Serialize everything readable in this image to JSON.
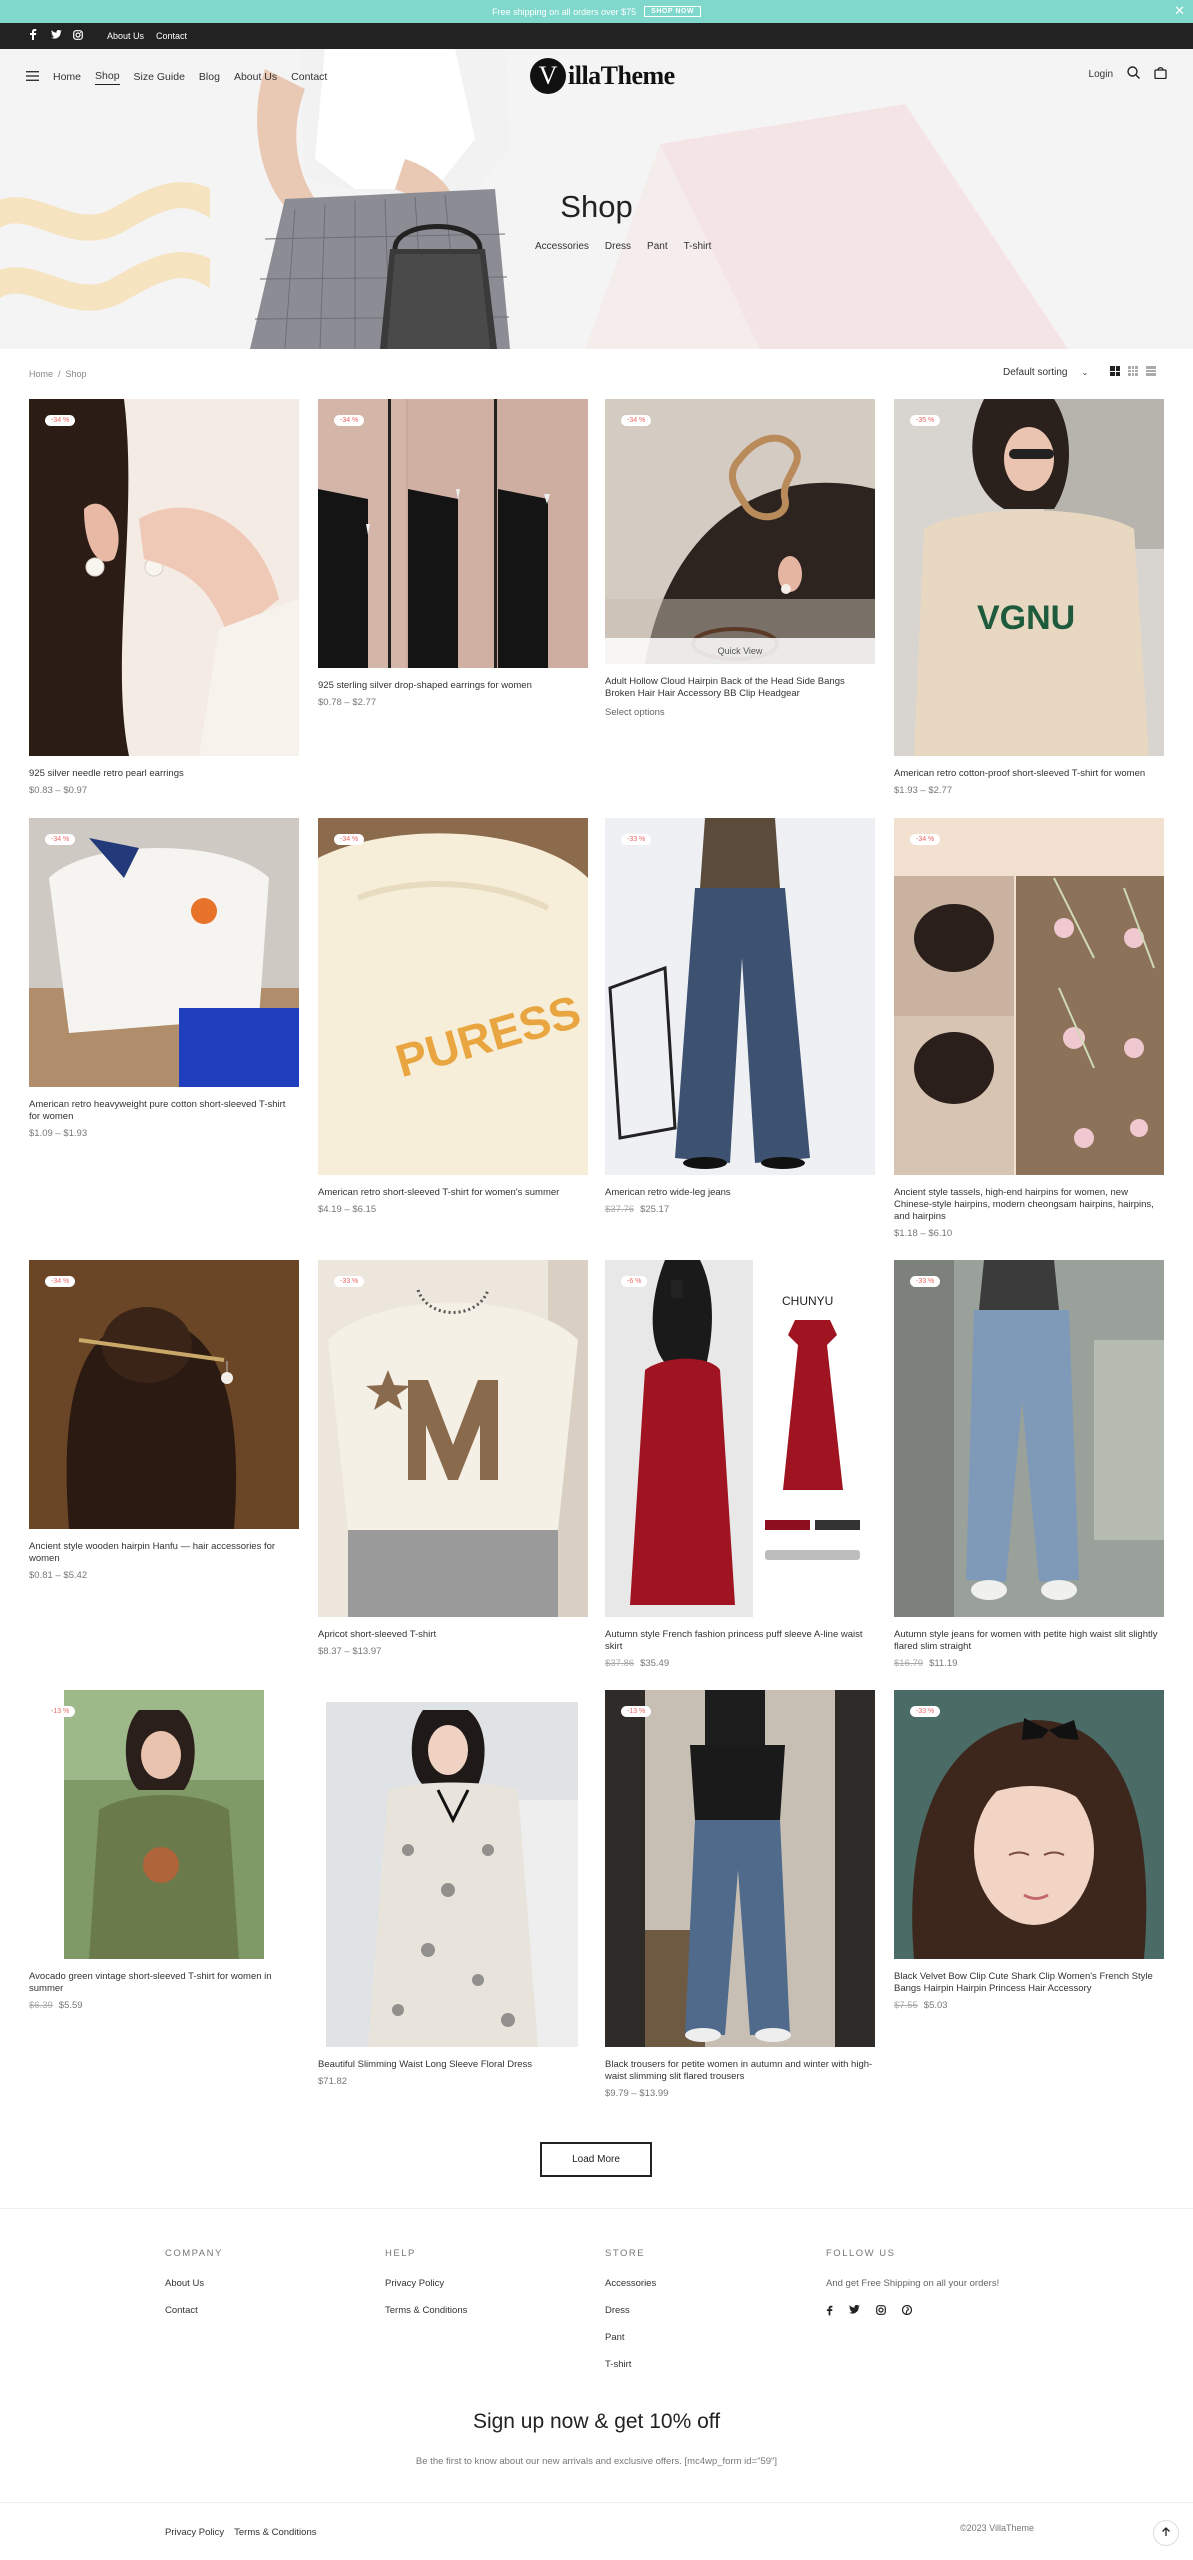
{
  "announcement": {
    "text": "Free shipping on all orders over $75",
    "button": "SHOP NOW",
    "close": "✕"
  },
  "topbar": {
    "links": [
      "About Us",
      "Contact"
    ]
  },
  "header": {
    "nav": [
      "Home",
      "Shop",
      "Size Guide",
      "Blog",
      "About Us",
      "Contact"
    ],
    "active": "Shop",
    "logo_mark": "V",
    "logo_text": "illaTheme",
    "login": "Login"
  },
  "hero": {
    "title": "Shop",
    "categories": [
      "Accessories",
      "Dress",
      "Pant",
      "T-shirt"
    ]
  },
  "breadcrumb": {
    "home": "Home",
    "separator": "/",
    "current": "Shop"
  },
  "sorting": {
    "selected": "Default sorting"
  },
  "products": [
    {
      "name": "925 silver needle retro pearl earrings",
      "price": "$0.83 – $0.97",
      "old": "",
      "badge": "-34 %"
    },
    {
      "name": "925 sterling silver drop-shaped earrings for women",
      "price": "$0.78 – $2.77",
      "old": "",
      "badge": "-34 %"
    },
    {
      "name": "Adult Hollow Cloud Hairpin Back of the Head Side Bangs Broken Hair Hair Accessory BB Clip Headgear",
      "price": "",
      "old": "",
      "badge": "-34 %",
      "extra": "Select options",
      "quick": "Quick View"
    },
    {
      "name": "American retro cotton-proof short-sleeved T-shirt for women",
      "price": "$1.93 – $2.77",
      "old": "",
      "badge": "-35 %"
    },
    {
      "name": "American retro heavyweight pure cotton short-sleeved T-shirt for women",
      "price": "$1.09 – $1.93",
      "old": "",
      "badge": "-34 %"
    },
    {
      "name": "American retro short-sleeved T-shirt for women's summer",
      "price": "$4.19 – $6.15",
      "old": "",
      "badge": "-34 %"
    },
    {
      "name": "American retro wide-leg jeans",
      "price": "$25.17",
      "old": "$37.76",
      "badge": "-33 %"
    },
    {
      "name": "Ancient style tassels, high-end hairpins for women, new Chinese-style hairpins, modern cheongsam hairpins, hairpins, and hairpins",
      "price": "$1.18 – $6.10",
      "old": "",
      "badge": "-34 %"
    },
    {
      "name": "Ancient style wooden hairpin Hanfu — hair accessories for women",
      "price": "$0.81 – $5.42",
      "old": "",
      "badge": "-34 %"
    },
    {
      "name": "Apricot short-sleeved T-shirt",
      "price": "$8.37 – $13.97",
      "old": "",
      "badge": "-33 %"
    },
    {
      "name": "Autumn style French fashion princess puff sleeve A-line waist skirt",
      "price": "$35.49",
      "old": "$37.86",
      "badge": "-6 %"
    },
    {
      "name": "Autumn style jeans for women with petite high waist slit slightly flared slim straight",
      "price": "$11.19",
      "old": "$16.79",
      "badge": "-33 %"
    },
    {
      "name": "Avocado green vintage short-sleeved T-shirt for women in summer",
      "price": "$5.59",
      "old": "$6.39",
      "badge": "-13 %"
    },
    {
      "name": "Beautiful Slimming Waist Long Sleeve Floral Dress",
      "price": "$71.82",
      "old": "",
      "badge": ""
    },
    {
      "name": "Black trousers for petite women in autumn and winter with high-waist slimming slit flared trousers",
      "price": "$9.79 – $13.99",
      "old": "",
      "badge": "-13 %"
    },
    {
      "name": "Black Velvet Bow Clip Cute Shark Clip Women's French Style Bangs Hairpin Hairpin Princess Hair Accessory",
      "price": "$5.03",
      "old": "$7.55",
      "badge": "-33 %"
    }
  ],
  "load_more": "Load More",
  "footer": {
    "company": {
      "title": "COMPANY",
      "items": [
        "About Us",
        "Contact"
      ]
    },
    "help": {
      "title": "HELP",
      "items": [
        "Privacy Policy",
        "Terms & Conditions"
      ]
    },
    "store": {
      "title": "STORE",
      "items": [
        "Accessories",
        "Dress",
        "Pant",
        "T-shirt"
      ]
    },
    "follow": {
      "title": "FOLLOW US",
      "text": "And get Free Shipping on all your orders!"
    },
    "signup_title": "Sign up now & get 10% off",
    "signup_sub": "Be the first to know about our new arrivals and exclusive offers. [mc4wp_form id=\"59\"]",
    "bottom_links": [
      "Privacy Policy",
      "Terms & Conditions"
    ],
    "copyright": "©2023 VillaTheme"
  }
}
